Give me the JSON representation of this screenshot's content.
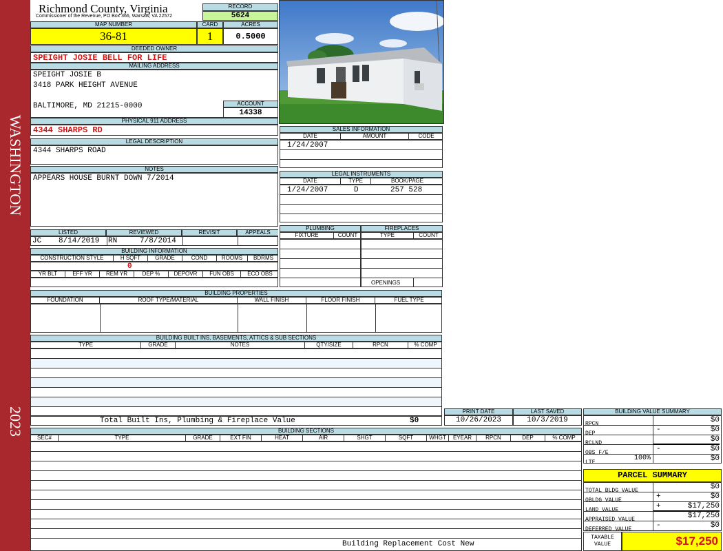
{
  "district": "WASHINGTON",
  "year": "2023",
  "county": "Richmond County, Virginia",
  "commissioner": "Commissioner of the Revenue, PO Box 366, Warsaw, VA 22572",
  "record": {
    "label": "RECORD",
    "value": "5624"
  },
  "map_number": {
    "label": "MAP NUMBER",
    "value": "36-81"
  },
  "card": {
    "label": "CARD",
    "value": "1"
  },
  "acres": {
    "label": "ACRES",
    "value": "0.5000"
  },
  "deeded_owner": {
    "label": "DEEDED OWNER",
    "value": "SPEIGHT JOSIE BELL FOR LIFE"
  },
  "mailing_address": {
    "label": "MAILING ADDRESS",
    "line1": "SPEIGHT JOSIE B",
    "line2": "3418 PARK HEIGHT AVENUE",
    "line3": "BALTIMORE, MD 21215-0000"
  },
  "account": {
    "label": "ACCOUNT",
    "value": "14338"
  },
  "physical_address": {
    "label": "PHYSICAL 911 ADDRESS",
    "value": "4344 SHARPS RD"
  },
  "legal_description": {
    "label": "LEGAL DESCRIPTION",
    "value": "4344 SHARPS ROAD"
  },
  "notes": {
    "label": "NOTES",
    "value": "APPEARS HOUSE BURNT DOWN 7/2014"
  },
  "review": {
    "listed_label": "LISTED",
    "reviewed_label": "REVIEWED",
    "revisit_label": "REVISIT",
    "appeals_label": "APPEALS",
    "listed_by": "JC",
    "listed_date": "8/14/2019",
    "reviewed_by": "RN",
    "reviewed_date": "7/8/2014"
  },
  "building_info": {
    "title": "BUILDING INFORMATION",
    "headers1": [
      "CONSTRUCTION STYLE",
      "H SQFT",
      "GRADE",
      "COND",
      "ROOMS",
      "BDRMS"
    ],
    "hsqft": "0",
    "headers2": [
      "YR BLT",
      "EFF YR",
      "REM YR",
      "DEP %",
      "DEPOVR",
      "FUN OBS",
      "ECO OBS"
    ]
  },
  "sales": {
    "title": "SALES INFORMATION",
    "headers": [
      "DATE",
      "AMOUNT",
      "CODE"
    ],
    "rows": [
      [
        "1/24/2007",
        "",
        ""
      ]
    ]
  },
  "legal_instruments": {
    "title": "LEGAL INSTRUMENTS",
    "headers": [
      "DATE",
      "TYPE",
      "BOOK/PAGE"
    ],
    "rows": [
      [
        "1/24/2007",
        "D",
        "257 528"
      ]
    ]
  },
  "plumbing": {
    "title": "PLUMBING",
    "headers": [
      "FIXTURE",
      "COUNT"
    ]
  },
  "fireplaces": {
    "title": "FIREPLACES",
    "headers": [
      "TYPE",
      "COUNT"
    ],
    "openings": "OPENINGS"
  },
  "building_properties": {
    "title": "BUILDING PROPERTIES",
    "headers": [
      "FOUNDATION",
      "ROOF TYPE/MATERIAL",
      "WALL FINISH",
      "FLOOR FINISH",
      "FUEL TYPE"
    ]
  },
  "built_ins": {
    "title": "BUILDING BUILT INS, BASEMENTS, ATTICS & SUB SECTIONS",
    "headers": [
      "TYPE",
      "GRADE",
      "NOTES",
      "QTY/SIZE",
      "RPCN",
      "% COMP"
    ],
    "total_label": "Total Built Ins, Plumbing & Fireplace Value",
    "total_value": "$0"
  },
  "dates": {
    "print_label": "PRINT DATE",
    "print_value": "10/26/2023",
    "saved_label": "LAST SAVED",
    "saved_value": "10/3/2019"
  },
  "building_sections": {
    "title": "BUILDING SECTIONS",
    "headers": [
      "SEC#",
      "TYPE",
      "GRADE",
      "EXT FIN",
      "HEAT",
      "AIR",
      "SHGT",
      "SQFT",
      "WHGT",
      "EYEAR",
      "RPCN",
      "DEP",
      "% COMP"
    ],
    "footer": "Building Replacement Cost New"
  },
  "building_value_summary": {
    "title": "BUILDING VALUE SUMMARY",
    "rows": [
      {
        "label": "RPCN",
        "sign": "",
        "value": "$0"
      },
      {
        "label": "DEP",
        "sign": "-",
        "value": "$0"
      },
      {
        "label": "RCLND",
        "sign": "",
        "value": "$0"
      },
      {
        "label": "OBS F/E",
        "sign": "-",
        "value": "$0"
      },
      {
        "label": "LTF",
        "pct": "100%",
        "sign": "",
        "value": "$0"
      }
    ]
  },
  "parcel_summary": {
    "title": "PARCEL SUMMARY",
    "rows": [
      {
        "label": "TOTAL BLDG VALUE",
        "sign": "",
        "value": "$0"
      },
      {
        "label": "OBLDG VALUE",
        "sign": "+",
        "value": "$0"
      },
      {
        "label": "LAND VALUE",
        "sign": "+",
        "value": "$17,250"
      },
      {
        "label": "APPRAISED VALUE",
        "sign": "",
        "value": "$17,250"
      },
      {
        "label": "DEFERRED VALUE",
        "sign": "-",
        "value": "$0"
      }
    ],
    "taxable_label": "TAXABLE VALUE",
    "taxable_value": "$17,250"
  },
  "colors": {
    "sidebar": "#a8282e",
    "header": "#b9dbe4",
    "highlight_yellow": "#ffff00",
    "record_green": "#c9f59a",
    "red_text": "#d21414"
  }
}
